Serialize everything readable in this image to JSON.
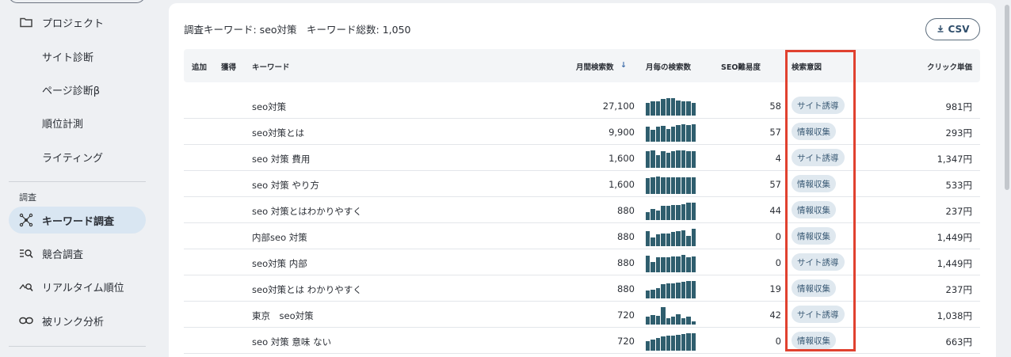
{
  "sidebar": {
    "items": [
      {
        "label": "プロジェクト",
        "icon": "folder-icon"
      },
      {
        "label": "サイト診断"
      },
      {
        "label": "ページ診断β"
      },
      {
        "label": "順位計測"
      },
      {
        "label": "ライティング"
      }
    ],
    "section_label": "調査",
    "research_items": [
      {
        "label": "キーワード調査",
        "icon": "keyword-network-icon",
        "active": true
      },
      {
        "label": "競合調査",
        "icon": "competitor-search-icon"
      },
      {
        "label": "リアルタイム順位",
        "icon": "realtime-rank-icon"
      },
      {
        "label": "被リンク分析",
        "icon": "link-icon"
      }
    ]
  },
  "main": {
    "summary": "調査キーワード: seo対策　キーワード総数: 1,050",
    "csv_label": "CSV",
    "headers": {
      "add": "追加",
      "acquire": "獲得",
      "keyword": "キーワード",
      "monthly": "月間検索数",
      "sort_icon": "↓",
      "trend": "月毎の検索数",
      "difficulty": "SEO難易度",
      "intent": "検索意図",
      "cpc": "クリック単価"
    },
    "rows": [
      {
        "keyword": "seo対策",
        "volume": "27,100",
        "difficulty": "58",
        "intent": "サイト誘導",
        "cpc": "981円",
        "trend": [
          0.75,
          0.8,
          0.8,
          0.95,
          1.0,
          1.0,
          0.85,
          0.8,
          0.8,
          0.75
        ]
      },
      {
        "keyword": "seo対策とは",
        "volume": "9,900",
        "difficulty": "57",
        "intent": "情報収集",
        "cpc": "293円",
        "trend": [
          0.85,
          0.7,
          0.85,
          0.9,
          0.75,
          0.85,
          0.95,
          1.0,
          0.95,
          1.0
        ]
      },
      {
        "keyword": "seo 対策 費用",
        "volume": "1,600",
        "difficulty": "4",
        "intent": "サイト誘導",
        "cpc": "1,347円",
        "trend": [
          0.95,
          1.0,
          0.75,
          0.95,
          0.85,
          0.95,
          1.0,
          1.0,
          0.95,
          0.95
        ]
      },
      {
        "keyword": "seo 対策 やり方",
        "volume": "1,600",
        "difficulty": "57",
        "intent": "情報収集",
        "cpc": "533円",
        "trend": [
          0.9,
          0.95,
          1.0,
          0.95,
          0.95,
          0.95,
          0.95,
          0.95,
          0.95,
          0.95
        ]
      },
      {
        "keyword": "seo 対策とはわかりやすく",
        "volume": "880",
        "difficulty": "44",
        "intent": "情報収集",
        "cpc": "237円",
        "trend": [
          0.45,
          0.65,
          0.55,
          0.8,
          0.8,
          0.85,
          0.85,
          0.9,
          1.0,
          1.0
        ]
      },
      {
        "keyword": "内部seo 対策",
        "volume": "880",
        "difficulty": "0",
        "intent": "情報収集",
        "cpc": "1,449円",
        "trend": [
          0.85,
          0.5,
          0.7,
          0.75,
          0.75,
          0.8,
          0.85,
          0.9,
          0.6,
          1.0
        ]
      },
      {
        "keyword": "seo対策 内部",
        "volume": "880",
        "difficulty": "0",
        "intent": "サイト誘導",
        "cpc": "1,449円",
        "trend": [
          0.95,
          0.6,
          0.85,
          0.85,
          0.85,
          0.9,
          0.9,
          1.0,
          0.85,
          0.9
        ]
      },
      {
        "keyword": "seo対策とは わかりやすく",
        "volume": "880",
        "difficulty": "19",
        "intent": "情報収集",
        "cpc": "237円",
        "trend": [
          0.45,
          0.5,
          0.6,
          0.8,
          0.85,
          0.85,
          0.9,
          0.95,
          1.0,
          1.0
        ]
      },
      {
        "keyword": "東京　seo対策",
        "volume": "720",
        "difficulty": "42",
        "intent": "サイト誘導",
        "cpc": "1,038円",
        "trend": [
          0.45,
          0.55,
          0.5,
          1.0,
          0.35,
          0.45,
          0.6,
          0.35,
          0.45,
          0.2
        ]
      },
      {
        "keyword": "seo 対策 意味 ない",
        "volume": "720",
        "difficulty": "0",
        "intent": "情報収集",
        "cpc": "663円",
        "trend": [
          0.55,
          0.65,
          0.75,
          0.8,
          0.85,
          0.85,
          0.9,
          0.95,
          1.0,
          1.0
        ]
      }
    ]
  },
  "colors": {
    "accent": "#2f5e6e",
    "highlight": "#e0412f",
    "chip_bg": "#dfe8ef",
    "active_nav": "#d9e6f2"
  }
}
